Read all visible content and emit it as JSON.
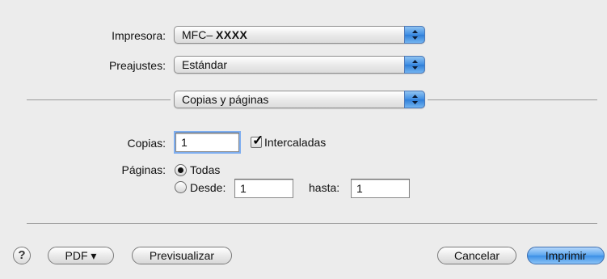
{
  "printer": {
    "label": "Impresora:",
    "value_prefix": "MFC–",
    "value_model": "XXXX"
  },
  "presets": {
    "label": "Preajustes:",
    "value": "Estándar"
  },
  "panel_menu": {
    "value": "Copias y páginas"
  },
  "copies": {
    "label": "Copias:",
    "value": "1",
    "collated_label": "Intercaladas",
    "collated_checked": true
  },
  "pages": {
    "label": "Páginas:",
    "all_label": "Todas",
    "from_label": "Desde:",
    "from_value": "1",
    "to_label": "hasta:",
    "to_value": "1",
    "selected": "all"
  },
  "footer": {
    "help_label": "?",
    "pdf_label": "PDF ▾",
    "preview_label": "Previsualizar",
    "cancel_label": "Cancelar",
    "print_label": "Imprimir"
  },
  "colors": {
    "accent": "#3b8fe6",
    "background": "#ececec"
  }
}
